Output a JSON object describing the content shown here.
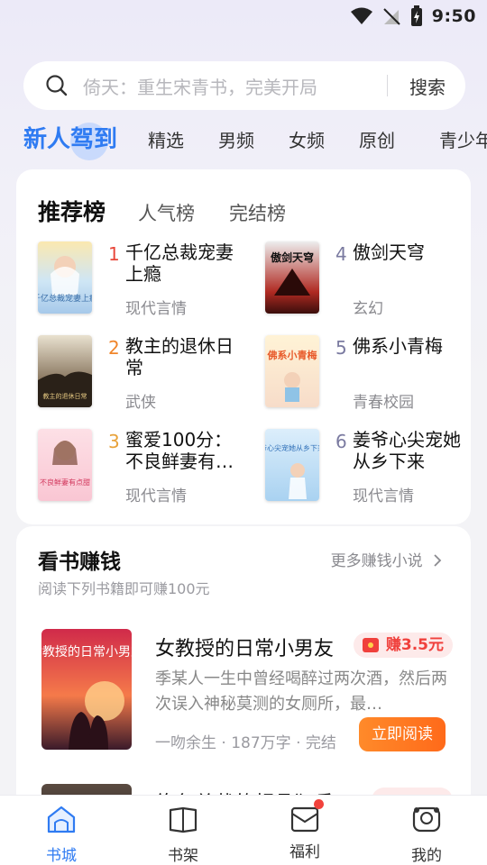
{
  "status_bar": {
    "time": "9:50"
  },
  "search": {
    "placeholder": "倚天：重生宋青书，完美开局",
    "button": "搜索"
  },
  "category_tabs": [
    {
      "label": "新人驾到",
      "active": true
    },
    {
      "label": "精选"
    },
    {
      "label": "男频"
    },
    {
      "label": "女频"
    },
    {
      "label": "原创"
    },
    {
      "label": "青少年"
    }
  ],
  "rank": {
    "tabs": [
      "推荐榜",
      "人气榜",
      "完结榜"
    ],
    "items": [
      {
        "rank": "1",
        "title": "千亿总裁宠妻上瘾",
        "genre": "现代言情",
        "cover_text": "千亿总裁宠妻上瘾",
        "rank_color": "#e8473a"
      },
      {
        "rank": "2",
        "title": "教主的退休日常",
        "genre": "武侠",
        "cover_text": "教主的退休日常",
        "rank_color": "#f0852a"
      },
      {
        "rank": "3",
        "title": "蜜爱100分：不良鲜妻有…",
        "genre": "现代言情",
        "cover_text": "不良鲜妻有点甜",
        "rank_color": "#e8a23a"
      },
      {
        "rank": "4",
        "title": "傲剑天穹",
        "genre": "玄幻",
        "cover_text": "傲剑天穹",
        "rank_color": "#7a7aa0"
      },
      {
        "rank": "5",
        "title": "佛系小青梅",
        "genre": "青春校园",
        "cover_text": "佛系小青梅",
        "rank_color": "#7a7aa0"
      },
      {
        "rank": "6",
        "title": "姜爷心尖宠她从乡下来",
        "genre": "现代言情",
        "cover_text": "姜爷心尖宠她从乡下来",
        "rank_color": "#7a7aa0"
      }
    ]
  },
  "earn": {
    "title": "看书赚钱",
    "more": "更多赚钱小说",
    "subtitle": "阅读下列书籍即可赚100元",
    "book": {
      "title": "女教授的日常小男友",
      "reward": "赚3.5元",
      "desc": "季某人一生中曾经喝醉过两次酒，然后两次误入神秘莫测的女厕所，最…",
      "meta": "一吻余生 · 187万字 · 完结",
      "button": "立即阅读",
      "cover_text": "女教授的日常小男友"
    },
    "book2": {
      "title": "绝色总裁的超品狂兵"
    }
  },
  "bottom_nav": [
    {
      "label": "书城",
      "icon": "bookstore-icon",
      "active": true
    },
    {
      "label": "书架",
      "icon": "bookshelf-icon"
    },
    {
      "label": "福利",
      "icon": "welfare-icon",
      "badge": true
    },
    {
      "label": "我的",
      "icon": "profile-icon"
    }
  ],
  "colors": {
    "accent": "#2f7bf2",
    "orange": "#ff7a22",
    "red": "#f0403c"
  }
}
